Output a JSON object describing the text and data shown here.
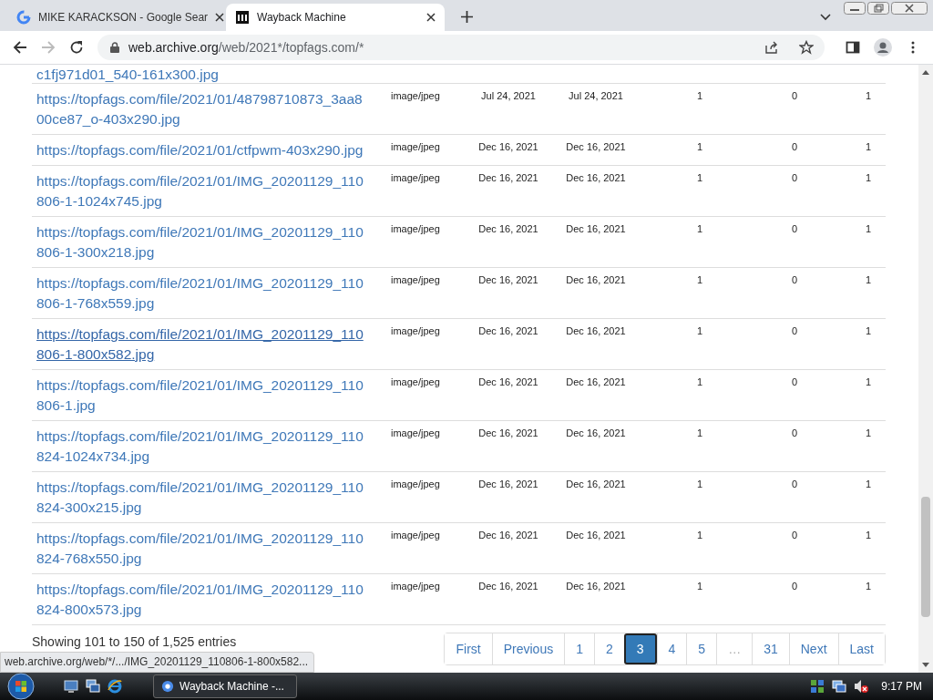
{
  "browser": {
    "tabs": [
      {
        "title": "MIKE KARACKSON - Google Sear",
        "selected": false
      },
      {
        "title": "Wayback Machine",
        "selected": true
      }
    ],
    "nav": {
      "back_disabled": false,
      "forward_disabled": true
    },
    "address": {
      "host": "web.archive.org",
      "path": "/web/2021*/topfags.com/*"
    }
  },
  "table": {
    "partial_row": "c1fj971d01_540-161x300.jpg",
    "rows": [
      {
        "url": "https://topfags.com/file/2021/01/48798710873_3aa800ce87_o-403x290.jpg",
        "type": "image/jpeg",
        "from": "Jul 24, 2021",
        "to": "Jul 24, 2021",
        "captures": "1",
        "duplicates": "0",
        "uniques": "1",
        "hovered": false
      },
      {
        "url": "https://topfags.com/file/2021/01/ctfpwm-403x290.jpg",
        "type": "image/jpeg",
        "from": "Dec 16, 2021",
        "to": "Dec 16, 2021",
        "captures": "1",
        "duplicates": "0",
        "uniques": "1",
        "hovered": false
      },
      {
        "url": "https://topfags.com/file/2021/01/IMG_20201129_110806-1-1024x745.jpg",
        "type": "image/jpeg",
        "from": "Dec 16, 2021",
        "to": "Dec 16, 2021",
        "captures": "1",
        "duplicates": "0",
        "uniques": "1",
        "hovered": false
      },
      {
        "url": "https://topfags.com/file/2021/01/IMG_20201129_110806-1-300x218.jpg",
        "type": "image/jpeg",
        "from": "Dec 16, 2021",
        "to": "Dec 16, 2021",
        "captures": "1",
        "duplicates": "0",
        "uniques": "1",
        "hovered": false
      },
      {
        "url": "https://topfags.com/file/2021/01/IMG_20201129_110806-1-768x559.jpg",
        "type": "image/jpeg",
        "from": "Dec 16, 2021",
        "to": "Dec 16, 2021",
        "captures": "1",
        "duplicates": "0",
        "uniques": "1",
        "hovered": false
      },
      {
        "url": "https://topfags.com/file/2021/01/IMG_20201129_110806-1-800x582.jpg",
        "type": "image/jpeg",
        "from": "Dec 16, 2021",
        "to": "Dec 16, 2021",
        "captures": "1",
        "duplicates": "0",
        "uniques": "1",
        "hovered": true
      },
      {
        "url": "https://topfags.com/file/2021/01/IMG_20201129_110806-1.jpg",
        "type": "image/jpeg",
        "from": "Dec 16, 2021",
        "to": "Dec 16, 2021",
        "captures": "1",
        "duplicates": "0",
        "uniques": "1",
        "hovered": false
      },
      {
        "url": "https://topfags.com/file/2021/01/IMG_20201129_110824-1024x734.jpg",
        "type": "image/jpeg",
        "from": "Dec 16, 2021",
        "to": "Dec 16, 2021",
        "captures": "1",
        "duplicates": "0",
        "uniques": "1",
        "hovered": false
      },
      {
        "url": "https://topfags.com/file/2021/01/IMG_20201129_110824-300x215.jpg",
        "type": "image/jpeg",
        "from": "Dec 16, 2021",
        "to": "Dec 16, 2021",
        "captures": "1",
        "duplicates": "0",
        "uniques": "1",
        "hovered": false
      },
      {
        "url": "https://topfags.com/file/2021/01/IMG_20201129_110824-768x550.jpg",
        "type": "image/jpeg",
        "from": "Dec 16, 2021",
        "to": "Dec 16, 2021",
        "captures": "1",
        "duplicates": "0",
        "uniques": "1",
        "hovered": false
      },
      {
        "url": "https://topfags.com/file/2021/01/IMG_20201129_110824-800x573.jpg",
        "type": "image/jpeg",
        "from": "Dec 16, 2021",
        "to": "Dec 16, 2021",
        "captures": "1",
        "duplicates": "0",
        "uniques": "1",
        "hovered": false
      }
    ]
  },
  "summary": "Showing 101 to 150 of 1,525 entries",
  "pagination": [
    {
      "label": "First",
      "selected": false,
      "disabled": false
    },
    {
      "label": "Previous",
      "selected": false,
      "disabled": false
    },
    {
      "label": "1",
      "selected": false,
      "disabled": false
    },
    {
      "label": "2",
      "selected": false,
      "disabled": false
    },
    {
      "label": "3",
      "selected": true,
      "disabled": false
    },
    {
      "label": "4",
      "selected": false,
      "disabled": false
    },
    {
      "label": "5",
      "selected": false,
      "disabled": false
    },
    {
      "label": "…",
      "selected": false,
      "disabled": true
    },
    {
      "label": "31",
      "selected": false,
      "disabled": false
    },
    {
      "label": "Next",
      "selected": false,
      "disabled": false
    },
    {
      "label": "Last",
      "selected": false,
      "disabled": false
    }
  ],
  "status_url": "web.archive.org/web/*/.../IMG_20201129_110806-1-800x582...",
  "taskbar": {
    "task": "Wayback Machine -...",
    "clock": "9:17 PM"
  }
}
